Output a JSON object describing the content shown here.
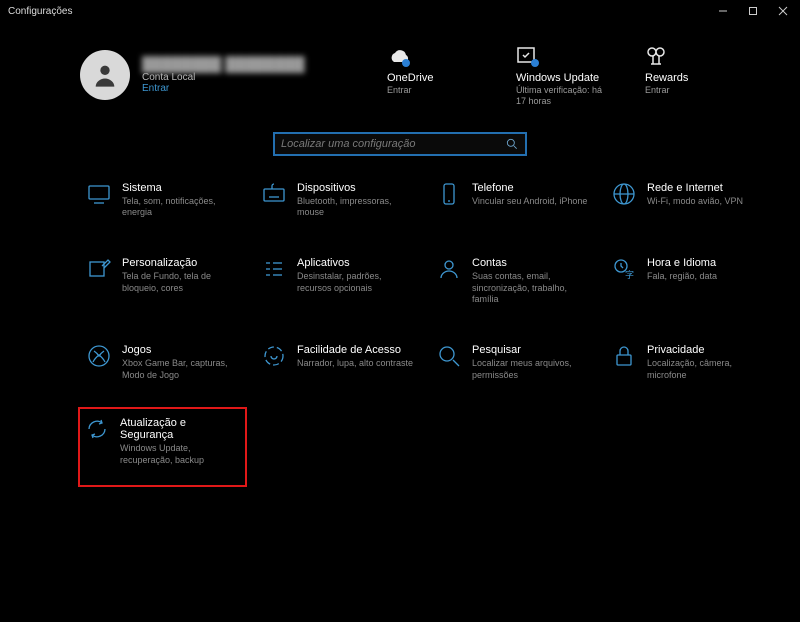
{
  "window": {
    "title": "Configurações"
  },
  "user": {
    "name": "████████ ████████",
    "account_type": "Conta Local",
    "signin_link": "Entrar"
  },
  "status": {
    "onedrive": {
      "title": "OneDrive",
      "sub": "Entrar"
    },
    "update": {
      "title": "Windows Update",
      "sub": "Última verificação: há 17 horas"
    },
    "rewards": {
      "title": "Rewards",
      "sub": "Entrar"
    }
  },
  "search": {
    "placeholder": "Localizar uma configuração"
  },
  "categories": [
    {
      "id": "system",
      "title": "Sistema",
      "sub": "Tela, som, notificações, energia"
    },
    {
      "id": "devices",
      "title": "Dispositivos",
      "sub": "Bluetooth, impressoras, mouse"
    },
    {
      "id": "phone",
      "title": "Telefone",
      "sub": "Vincular seu Android, iPhone"
    },
    {
      "id": "network",
      "title": "Rede e Internet",
      "sub": "Wi-Fi, modo avião, VPN"
    },
    {
      "id": "personalization",
      "title": "Personalização",
      "sub": "Tela de Fundo, tela de bloqueio, cores"
    },
    {
      "id": "apps",
      "title": "Aplicativos",
      "sub": "Desinstalar, padrões, recursos opcionais"
    },
    {
      "id": "accounts",
      "title": "Contas",
      "sub": "Suas contas, email, sincronização, trabalho, família"
    },
    {
      "id": "time",
      "title": "Hora e Idioma",
      "sub": "Fala, região, data"
    },
    {
      "id": "gaming",
      "title": "Jogos",
      "sub": "Xbox Game Bar, capturas, Modo de Jogo"
    },
    {
      "id": "ease",
      "title": "Facilidade de Acesso",
      "sub": "Narrador, lupa, alto contraste"
    },
    {
      "id": "search",
      "title": "Pesquisar",
      "sub": "Localizar meus arquivos, permissões"
    },
    {
      "id": "privacy",
      "title": "Privacidade",
      "sub": "Localização, câmera, microfone"
    },
    {
      "id": "update",
      "title": "Atualização e Segurança",
      "sub": "Windows Update, recuperação, backup"
    }
  ]
}
